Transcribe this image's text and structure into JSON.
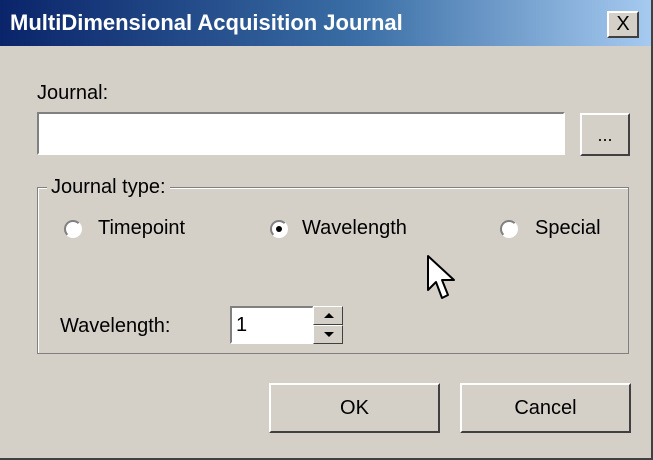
{
  "window": {
    "title": "MultiDimensional Acquisition Journal",
    "close_label": "X"
  },
  "journal": {
    "label": "Journal:",
    "value": "",
    "browse_label": "..."
  },
  "journal_type": {
    "legend": "Journal type:",
    "options": [
      {
        "label": "Timepoint",
        "selected": false
      },
      {
        "label": "Wavelength",
        "selected": true
      },
      {
        "label": "Special",
        "selected": false
      }
    ]
  },
  "wavelength": {
    "label": "Wavelength:",
    "value": "1"
  },
  "buttons": {
    "ok_label": "OK",
    "cancel_label": "Cancel"
  }
}
